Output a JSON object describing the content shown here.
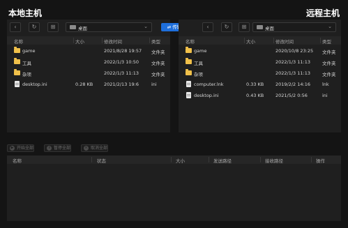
{
  "local": {
    "title": "本地主机",
    "path": "桌面",
    "columns": [
      "名称",
      "大小",
      "修改时间",
      "类型"
    ],
    "rows": [
      {
        "icon": "folder-icon",
        "name": "game",
        "size": "",
        "date": "2021/8/28 19:57",
        "type": "文件夹"
      },
      {
        "icon": "folder-icon",
        "name": "工具",
        "size": "",
        "date": "2022/1/3 10:50",
        "type": "文件夹"
      },
      {
        "icon": "folder-icon",
        "name": "杂项",
        "size": "",
        "date": "2022/1/3 11:13",
        "type": "文件夹"
      },
      {
        "icon": "file-icon",
        "name": "desktop.ini",
        "size": "0.28 KB",
        "date": "2021/2/13 19:6",
        "type": "ini"
      }
    ]
  },
  "remote": {
    "title": "远程主机",
    "path": "桌面",
    "columns": [
      "名称",
      "大小",
      "修改时间",
      "类型"
    ],
    "rows": [
      {
        "icon": "folder-icon",
        "name": "game",
        "size": "",
        "date": "2020/10/8 23:25",
        "type": "文件夹"
      },
      {
        "icon": "folder-icon",
        "name": "工具",
        "size": "",
        "date": "2022/1/3 11:13",
        "type": "文件夹"
      },
      {
        "icon": "folder-icon",
        "name": "杂项",
        "size": "",
        "date": "2022/1/3 11:13",
        "type": "文件夹"
      },
      {
        "icon": "file-icon",
        "name": "computer.lnk",
        "size": "0.33 KB",
        "date": "2019/2/2 14:16",
        "type": "lnk"
      },
      {
        "icon": "file-icon",
        "name": "desktop.ini",
        "size": "0.43 KB",
        "date": "2021/5/2 0:56",
        "type": "ini"
      }
    ]
  },
  "transfer_label": "传输",
  "queue_buttons": [
    "开始全部",
    "暂停全部",
    "取消全部"
  ],
  "queue_columns": [
    "名称",
    "状态",
    "大小",
    "发送路径",
    "接收路径",
    "操作"
  ],
  "accent": "#1e6fdc"
}
